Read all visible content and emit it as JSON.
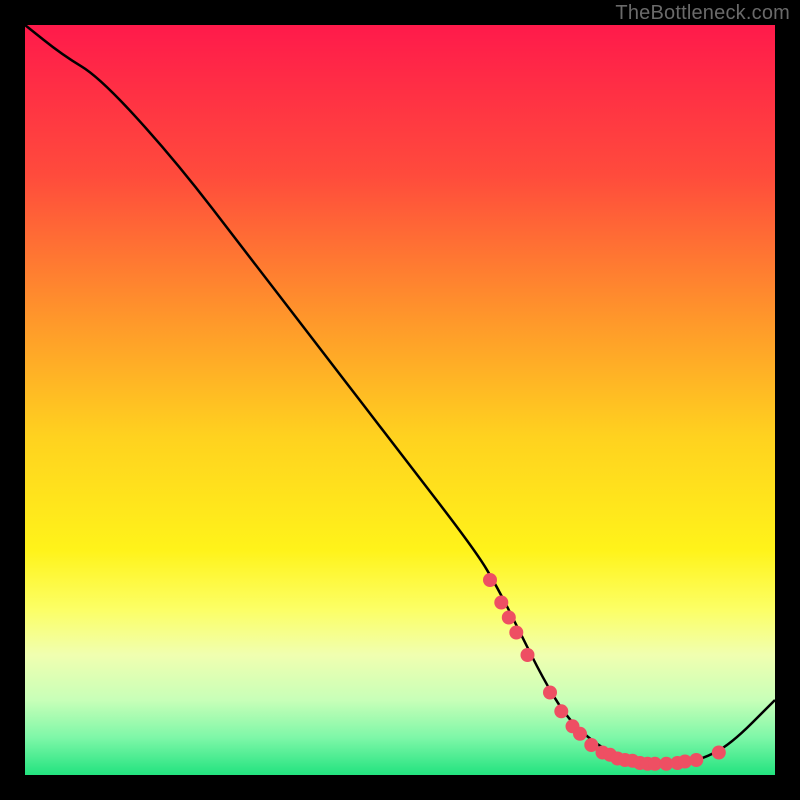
{
  "watermark": "TheBottleneck.com",
  "chart_data": {
    "type": "line",
    "title": "",
    "xlabel": "",
    "ylabel": "",
    "xlim": [
      0,
      100
    ],
    "ylim": [
      0,
      100
    ],
    "grid": false,
    "legend": false,
    "background_gradient": {
      "stops": [
        {
          "offset": 0.0,
          "color": "#ff1a4b"
        },
        {
          "offset": 0.2,
          "color": "#ff4b3c"
        },
        {
          "offset": 0.4,
          "color": "#ff9a2a"
        },
        {
          "offset": 0.55,
          "color": "#ffd21f"
        },
        {
          "offset": 0.7,
          "color": "#fff31a"
        },
        {
          "offset": 0.78,
          "color": "#fcff66"
        },
        {
          "offset": 0.84,
          "color": "#f0ffb0"
        },
        {
          "offset": 0.9,
          "color": "#c8ffb8"
        },
        {
          "offset": 0.95,
          "color": "#7ef7a8"
        },
        {
          "offset": 1.0,
          "color": "#22e37f"
        }
      ]
    },
    "series": [
      {
        "name": "curve",
        "color": "#000000",
        "x": [
          0,
          5,
          10,
          20,
          30,
          40,
          50,
          60,
          63,
          66,
          69,
          72,
          75,
          78,
          81,
          84,
          87,
          90,
          94,
          100
        ],
        "values": [
          100,
          96,
          93,
          82,
          69,
          56,
          43,
          30,
          25,
          19,
          13,
          8,
          5,
          3,
          2,
          1.5,
          1.5,
          2,
          4,
          10
        ]
      }
    ],
    "markers": {
      "color": "#ee4f63",
      "radius": 7,
      "points": [
        {
          "x": 62.0,
          "y": 26.0
        },
        {
          "x": 63.5,
          "y": 23.0
        },
        {
          "x": 64.5,
          "y": 21.0
        },
        {
          "x": 65.5,
          "y": 19.0
        },
        {
          "x": 67.0,
          "y": 16.0
        },
        {
          "x": 70.0,
          "y": 11.0
        },
        {
          "x": 71.5,
          "y": 8.5
        },
        {
          "x": 73.0,
          "y": 6.5
        },
        {
          "x": 74.0,
          "y": 5.5
        },
        {
          "x": 75.5,
          "y": 4.0
        },
        {
          "x": 77.0,
          "y": 3.0
        },
        {
          "x": 78.0,
          "y": 2.7
        },
        {
          "x": 79.0,
          "y": 2.2
        },
        {
          "x": 80.0,
          "y": 2.0
        },
        {
          "x": 81.0,
          "y": 1.9
        },
        {
          "x": 82.0,
          "y": 1.6
        },
        {
          "x": 83.0,
          "y": 1.5
        },
        {
          "x": 84.0,
          "y": 1.5
        },
        {
          "x": 85.5,
          "y": 1.5
        },
        {
          "x": 87.0,
          "y": 1.6
        },
        {
          "x": 88.0,
          "y": 1.8
        },
        {
          "x": 89.5,
          "y": 2.0
        },
        {
          "x": 92.5,
          "y": 3.0
        }
      ]
    }
  }
}
